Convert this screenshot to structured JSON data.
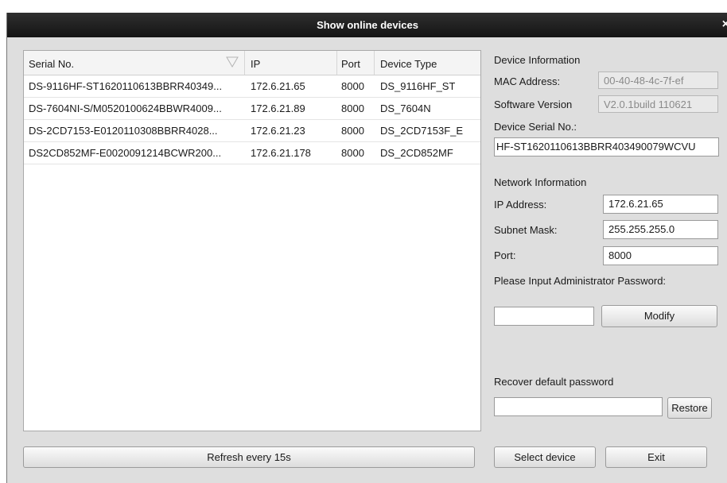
{
  "window": {
    "title": "Show online devices",
    "close_glyph": "×"
  },
  "table": {
    "columns": [
      "Serial No.",
      "IP",
      "Port",
      "Device Type"
    ],
    "rows": [
      [
        "DS-9116HF-ST1620110613BBRR40349...",
        "172.6.21.65",
        "8000",
        "DS_9116HF_ST"
      ],
      [
        "DS-7604NI-S/M0520100624BBWR4009...",
        "172.6.21.89",
        "8000",
        "DS_7604N"
      ],
      [
        "DS-2CD7153-E0120110308BBRR4028...",
        "172.6.21.23",
        "8000",
        "DS_2CD7153F_E"
      ],
      [
        "DS2CD852MF-E0020091214BCWR200...",
        "172.6.21.178",
        "8000",
        "DS_2CD852MF"
      ]
    ]
  },
  "device_info": {
    "section_label": "Device Information",
    "mac_label": "MAC Address:",
    "mac_value": "00-40-48-4c-7f-ef",
    "software_label": "Software Version",
    "software_value": "V2.0.1build 110621",
    "serial_label": "Device Serial No.:",
    "serial_value": "HF-ST1620110613BBRR403490079WCVU"
  },
  "network_info": {
    "section_label": "Network Information",
    "ip_label": "IP Address:",
    "ip_value": "172.6.21.65",
    "subnet_label": "Subnet Mask:",
    "subnet_value": "255.255.255.0",
    "port_label": "Port:",
    "port_value": "8000"
  },
  "password": {
    "prompt": "Please Input Administrator Password:",
    "value": "",
    "modify_label": "Modify"
  },
  "recover": {
    "label": "Recover default password",
    "value": "",
    "restore_label": "Restore"
  },
  "footer": {
    "refresh_label": "Refresh every 15s",
    "select_label": "Select device",
    "exit_label": "Exit"
  },
  "icons": {
    "sort": "sort-triangle-icon",
    "close": "close-icon"
  },
  "colors": {
    "titlebar": "#1e1e1e",
    "dialog_bg": "#dedede",
    "table_bg": "#ffffff"
  }
}
